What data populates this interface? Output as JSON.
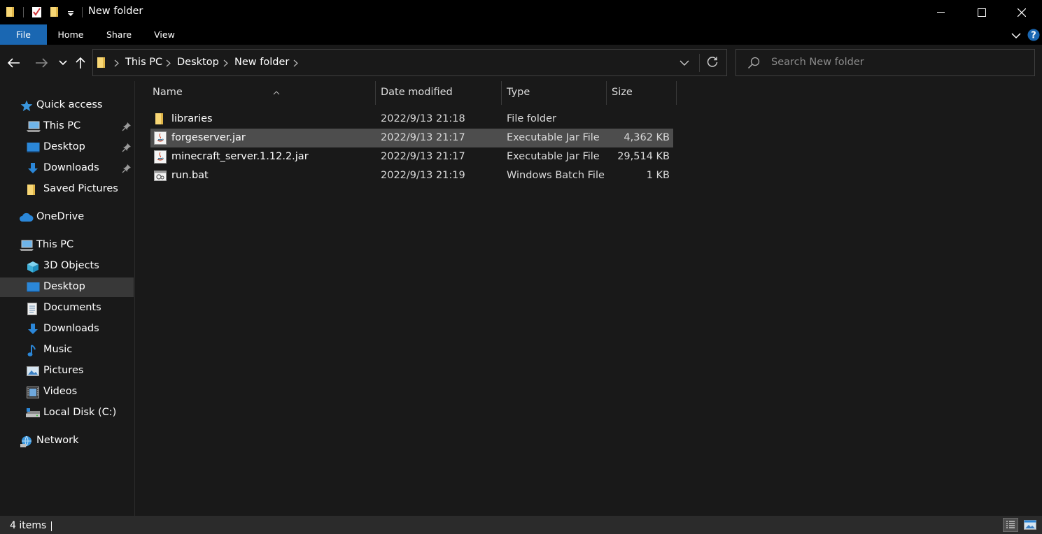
{
  "window": {
    "title": "New folder"
  },
  "ribbon": {
    "tabs": [
      "File",
      "Home",
      "Share",
      "View"
    ]
  },
  "address": {
    "crumbs": [
      "This PC",
      "Desktop",
      "New folder"
    ]
  },
  "search": {
    "placeholder": "Search New folder"
  },
  "nav": {
    "quick_access": "Quick access",
    "qa_items": [
      "This PC",
      "Desktop",
      "Downloads",
      "Saved Pictures"
    ],
    "onedrive": "OneDrive",
    "this_pc": "This PC",
    "pc_items": [
      "3D Objects",
      "Desktop",
      "Documents",
      "Downloads",
      "Music",
      "Pictures",
      "Videos",
      "Local Disk (C:)"
    ],
    "network": "Network",
    "selected": "Desktop"
  },
  "columns": {
    "name": "Name",
    "date": "Date modified",
    "type": "Type",
    "size": "Size"
  },
  "files": [
    {
      "name": "libraries",
      "date": "2022/9/13 21:18",
      "type": "File folder",
      "size": "",
      "icon": "folder-icon"
    },
    {
      "name": "forgeserver.jar",
      "date": "2022/9/13 21:17",
      "type": "Executable Jar File",
      "size": "4,362 KB",
      "icon": "java-jar-icon",
      "selected": true
    },
    {
      "name": "minecraft_server.1.12.2.jar",
      "date": "2022/9/13 21:17",
      "type": "Executable Jar File",
      "size": "29,514 KB",
      "icon": "java-jar-icon"
    },
    {
      "name": "run.bat",
      "date": "2022/9/13 21:19",
      "type": "Windows Batch File",
      "size": "1 KB",
      "icon": "batch-file-icon"
    }
  ],
  "status": {
    "items": "4 items"
  },
  "colors": {
    "accent": "#1a67b2",
    "background": "#191919",
    "selection": "#4d4d4d",
    "folder": "#f8d775"
  }
}
